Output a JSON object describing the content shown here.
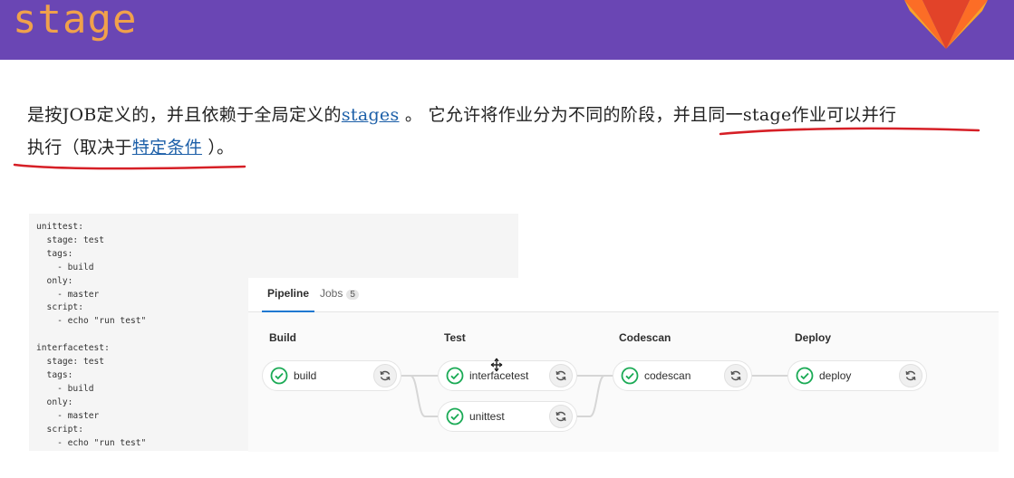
{
  "slide": {
    "title": "stage"
  },
  "paragraph": {
    "line1_a": "是按JOB定义的，并且依赖于全局定义的",
    "link_stages": "stages",
    "line1_b": " 。 它允许将作业分为不同的阶段，并且同一stage作业可以并行",
    "line2_a": "执行（取决于",
    "link_conditions": "特定条件",
    "line2_b": " ）。"
  },
  "code": {
    "lines": [
      "unittest:",
      "  stage: test",
      "  tags:",
      "    - build",
      "  only:",
      "    - master",
      "  script:",
      "    - echo \"run test\"",
      "",
      "interfacetest:",
      "  stage: test",
      "  tags:",
      "    - build",
      "  only:",
      "    - master",
      "  script:",
      "    - echo \"run test\""
    ]
  },
  "pipeline": {
    "tabs": {
      "pipeline": "Pipeline",
      "jobs": "Jobs",
      "jobs_count": "5"
    },
    "stages": [
      "Build",
      "Test",
      "Codescan",
      "Deploy"
    ],
    "jobs": {
      "build": "build",
      "interfacetest": "interfacetest",
      "unittest": "unittest",
      "codescan": "codescan",
      "deploy": "deploy"
    }
  },
  "colors": {
    "header": "#6a46b4",
    "title": "#f0a14b",
    "link": "#1c5fa8",
    "annotation": "#d61f26",
    "success": "#1aaa55"
  },
  "icons": [
    "gitlab-logo",
    "check-circle-icon",
    "retry-icon",
    "cursor-icon"
  ]
}
